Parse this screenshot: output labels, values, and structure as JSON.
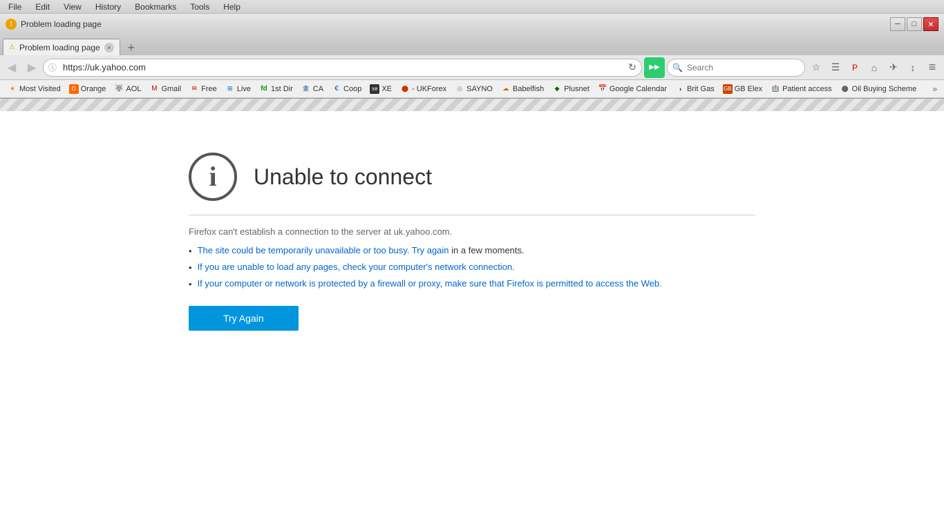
{
  "window": {
    "title": "Problem loading page",
    "warning_label": "!"
  },
  "menu": {
    "items": [
      "File",
      "Edit",
      "View",
      "History",
      "Bookmarks",
      "Tools",
      "Help"
    ]
  },
  "tab": {
    "label": "Problem loading page",
    "close_label": "×"
  },
  "new_tab_btn": "+",
  "nav": {
    "back_btn": "◀",
    "forward_btn": "▶",
    "info_icon": "ⓘ",
    "url": "https://uk.yahoo.com",
    "refresh_icon": "↻",
    "pocket_icon": "▶",
    "search_placeholder": "Search"
  },
  "toolbar": {
    "star_icon": "☆",
    "reader_icon": "☰",
    "pocket_icon": "P",
    "home_icon": "⌂",
    "share_icon": "✈",
    "sync_icon": "⚙",
    "menu_icon": "≡"
  },
  "bookmarks": {
    "items": [
      {
        "label": "Most Visited",
        "color": "#ff6600",
        "icon": "★"
      },
      {
        "label": "Orange",
        "color": "#ff6600",
        "icon": "O"
      },
      {
        "label": "AOL",
        "color": "#444",
        "icon": "A"
      },
      {
        "label": "Gmail",
        "color": "#cc0000",
        "icon": "M"
      },
      {
        "label": "Free",
        "color": "#cc0000",
        "icon": "F"
      },
      {
        "label": "Live",
        "color": "#0066cc",
        "icon": "L"
      },
      {
        "label": "1st Dir",
        "color": "#009900",
        "icon": "f"
      },
      {
        "label": "CA",
        "color": "#666",
        "icon": "C"
      },
      {
        "label": "Coop",
        "color": "#0055aa",
        "icon": "E"
      },
      {
        "label": "XE",
        "color": "#333",
        "icon": "✕"
      },
      {
        "label": "- UKForex",
        "color": "#cc3300",
        "icon": "⬤"
      },
      {
        "label": "SAYNO",
        "color": "#888",
        "icon": "◎"
      },
      {
        "label": "Babelfish",
        "color": "#cc6600",
        "icon": "☁"
      },
      {
        "label": "Plusnet",
        "color": "#006600",
        "icon": "◆"
      },
      {
        "label": "Google Calendar",
        "color": "#0066cc",
        "icon": "8"
      },
      {
        "label": "Brit Gas",
        "color": "#006699",
        "icon": "◑"
      },
      {
        "label": "GB Elex",
        "color": "#cc4400",
        "icon": "G"
      },
      {
        "label": "Patient access",
        "color": "#cc0000",
        "icon": "P"
      },
      {
        "label": "Oil Buying Scheme",
        "color": "#666",
        "icon": "⬤"
      }
    ],
    "more": "»"
  },
  "error": {
    "title": "Unable to connect",
    "subtitle": "Firefox can't establish a connection to the server at uk.yahoo.com.",
    "bullets": [
      {
        "link_part": "The site could be temporarily unavailable or too busy. Try again",
        "normal_part": " in a few moments."
      },
      {
        "link_part": "If you are unable to load any pages, check your computer's network connection.",
        "normal_part": ""
      },
      {
        "link_part": "If your computer or network is protected by a firewall or proxy, make sure that Firefox is permitted to access the Web.",
        "normal_part": ""
      }
    ],
    "try_again_label": "Try Again"
  }
}
